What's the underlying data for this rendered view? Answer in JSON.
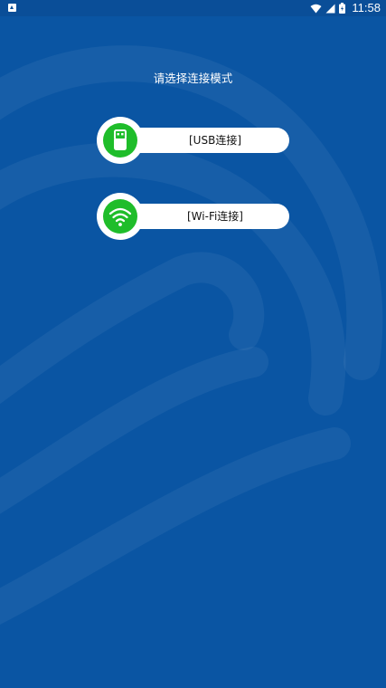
{
  "status_bar": {
    "time": "11:58",
    "icons": [
      "notification-icon",
      "wifi-signal-icon",
      "cell-signal-icon",
      "battery-icon"
    ]
  },
  "main": {
    "prompt": "请选择连接模式",
    "options": [
      {
        "label": "[USB连接]",
        "icon": "usb-icon"
      },
      {
        "label": "[Wi-Fi连接]",
        "icon": "wifi-icon"
      }
    ]
  },
  "colors": {
    "background": "#0a55a3",
    "status_bar": "#0a4e98",
    "accent_green": "#1fbd2a",
    "pill": "#ffffff"
  }
}
